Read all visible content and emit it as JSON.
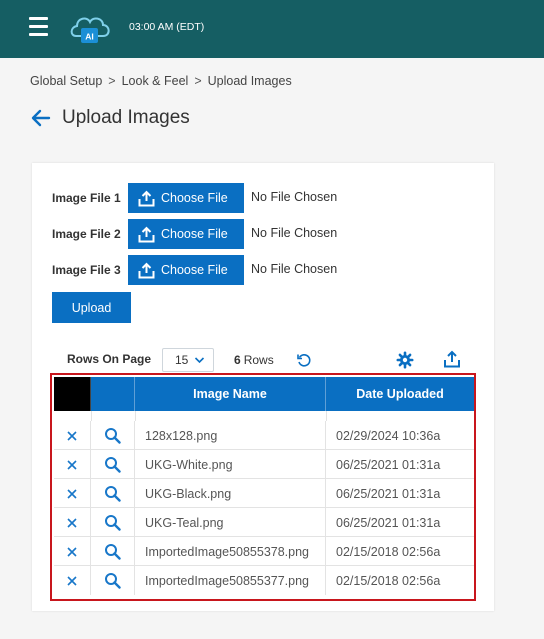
{
  "header": {
    "clock": "03:00 AM (EDT)",
    "logo_text": "AI",
    "brand_color": "#155e63"
  },
  "breadcrumb": {
    "items": [
      "Global Setup",
      "Look & Feel",
      "Upload Images"
    ],
    "separator": ">"
  },
  "page": {
    "title": "Upload Images"
  },
  "upload_form": {
    "files": [
      {
        "label": "Image File 1",
        "button": "Choose File",
        "status": "No File Chosen"
      },
      {
        "label": "Image File 2",
        "button": "Choose File",
        "status": "No File Chosen"
      },
      {
        "label": "Image File 3",
        "button": "Choose File",
        "status": "No File Chosen"
      }
    ],
    "upload_label": "Upload",
    "accent_color": "#0a6fc2"
  },
  "grid_toolbar": {
    "rows_on_page_label": "Rows On Page",
    "rows_on_page_value": "15",
    "row_count": "6",
    "row_count_label": "Rows"
  },
  "grid": {
    "columns": [
      "",
      "",
      "Image Name",
      "Date Uploaded"
    ],
    "rows": [
      {
        "name": "128x128.png",
        "date": "02/29/2024 10:36a"
      },
      {
        "name": "UKG-White.png",
        "date": "06/25/2021 01:31a"
      },
      {
        "name": "UKG-Black.png",
        "date": "06/25/2021 01:31a"
      },
      {
        "name": "UKG-Teal.png",
        "date": "06/25/2021 01:31a"
      },
      {
        "name": "ImportedImage50855378.png",
        "date": "02/15/2018 02:56a"
      },
      {
        "name": "ImportedImage50855377.png",
        "date": "02/15/2018 02:56a"
      }
    ],
    "highlight_color": "#c8161d"
  }
}
